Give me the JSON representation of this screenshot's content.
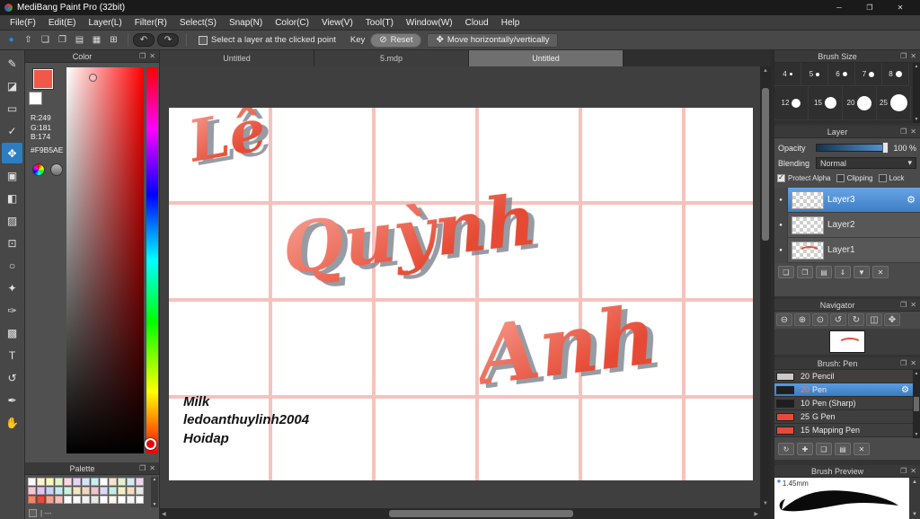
{
  "window": {
    "title": "MediBang Paint Pro (32bit)",
    "minimize": "─",
    "restore": "❐",
    "close": "✕"
  },
  "menu": [
    "File(F)",
    "Edit(E)",
    "Layer(L)",
    "Filter(R)",
    "Select(S)",
    "Snap(N)",
    "Color(C)",
    "View(V)",
    "Tool(T)",
    "Window(W)",
    "Cloud",
    "Help"
  ],
  "toolbar": {
    "icons": [
      {
        "name": "main-color-icon",
        "glyph": "●",
        "color": "#2f86d6"
      },
      {
        "name": "save-icon",
        "glyph": "⇧"
      },
      {
        "name": "comment-icon",
        "glyph": "❏"
      },
      {
        "name": "panels-icon",
        "glyph": "❐"
      },
      {
        "name": "grid-icon",
        "glyph": "▤"
      },
      {
        "name": "material-icon",
        "glyph": "▦"
      },
      {
        "name": "window-layout-icon",
        "glyph": "⊞"
      }
    ],
    "undo": "↶",
    "redo": "↷",
    "select_layer_label": "Select a layer at the clicked point",
    "key_label": "Key",
    "reset": {
      "icon": "⊘",
      "label": "Reset"
    },
    "move": {
      "icon": "✥",
      "label": "Move horizontally/vertically"
    }
  },
  "tools": [
    {
      "name": "pen-tool-icon",
      "glyph": "✎"
    },
    {
      "name": "eraser-tool-icon",
      "glyph": "◪"
    },
    {
      "name": "select-tool-icon",
      "glyph": "▭"
    },
    {
      "name": "auto-select-tool-icon",
      "glyph": "✓"
    },
    {
      "name": "move-tool-icon",
      "glyph": "✥",
      "active": true
    },
    {
      "name": "fill-tool-icon",
      "glyph": "▣"
    },
    {
      "name": "bucket-tool-icon",
      "glyph": "◧"
    },
    {
      "name": "gradient-tool-icon",
      "glyph": "▨"
    },
    {
      "name": "select-rect-tool-icon",
      "glyph": "⊡"
    },
    {
      "name": "lasso-tool-icon",
      "glyph": "○"
    },
    {
      "name": "magic-wand-tool-icon",
      "glyph": "✦"
    },
    {
      "name": "draw-tool-icon",
      "glyph": "✑"
    },
    {
      "name": "stamp-tool-icon",
      "glyph": "▩"
    },
    {
      "name": "text-tool-icon",
      "glyph": "T"
    },
    {
      "name": "rotate-tool-icon",
      "glyph": "↺"
    },
    {
      "name": "eyedropper-tool-icon",
      "glyph": "✒"
    },
    {
      "name": "hand-tool-icon",
      "glyph": "✋"
    }
  ],
  "color_panel": {
    "title": "Color",
    "r": "R:249",
    "g": "G:181",
    "b": "B:174",
    "hex": "#F9B5AE",
    "primary": "#F05848"
  },
  "palette_panel": {
    "title": "Palette",
    "footer": "| ---",
    "swatches": [
      "#ffffff",
      "#fdf3d0",
      "#faf6c0",
      "#e4f4c8",
      "#fad8e0",
      "#e6d6f2",
      "#d4e4f6",
      "#cdeef0",
      "#ffffff",
      "#f4e4ce",
      "#e2f0d4",
      "#d4e8f4",
      "#f0d6ea",
      "#f6c6d2",
      "#e0c6ee",
      "#c6d4f0",
      "#c6eaf0",
      "#cef0da",
      "#f0e8c2",
      "#f0d6c2",
      "#eec6c6",
      "#dadaf4",
      "#c6eede",
      "#f2eec4",
      "#eedcc4",
      "#e6e6e6",
      "#f08468",
      "#e84c38",
      "#f0a28e",
      "#f6c0b4",
      "#ffffff",
      "#f8f8f8",
      "#f0f0f0",
      "#e8e8e8",
      "#ffffff",
      "#fdf6ec",
      "#ffffff",
      "#f4f4f4",
      "#ffffff"
    ]
  },
  "tabs": [
    {
      "label": "Untitled"
    },
    {
      "label": "5.mdp"
    },
    {
      "label": "Untitled",
      "active": true
    }
  ],
  "canvas": {
    "lettering": {
      "line1": "Lê",
      "line2": "Quỳnh",
      "line3": "Anh"
    },
    "watermark": [
      "Milk",
      "ledoanthuylinh2004",
      "Hoidap"
    ]
  },
  "brush_size_panel": {
    "title": "Brush Size",
    "row1": [
      {
        "label": "4",
        "d": "3px"
      },
      {
        "label": "5",
        "d": "4px"
      },
      {
        "label": "6",
        "d": "5px"
      },
      {
        "label": "7",
        "d": "6px"
      },
      {
        "label": "8",
        "d": "7px"
      }
    ],
    "row2": [
      {
        "label": "12",
        "d": "10px"
      },
      {
        "label": "15",
        "d": "13px"
      },
      {
        "label": "20",
        "d": "16px"
      },
      {
        "label": "25",
        "d": "19px"
      }
    ]
  },
  "layer_panel": {
    "title": "Layer",
    "opacity_label": "Opacity",
    "opacity_value": "100 %",
    "blending_label": "Blending",
    "blending_value": "Normal",
    "caret": "▾",
    "visible_icon": "●",
    "gear_icon": "⚙",
    "checks": [
      {
        "label": "Protect Alpha",
        "checked": true
      },
      {
        "label": "Clipping"
      },
      {
        "label": "Lock"
      }
    ],
    "layers": [
      {
        "name": "Layer3",
        "active": true
      },
      {
        "name": "Layer2"
      },
      {
        "name": "Layer1",
        "scribble": true
      }
    ],
    "actions": [
      {
        "name": "new-layer-icon",
        "glyph": "❏"
      },
      {
        "name": "duplicate-layer-icon",
        "glyph": "❐"
      },
      {
        "name": "layer-folder-icon",
        "glyph": "▤"
      },
      {
        "name": "transfer-layer-icon",
        "glyph": "⇓"
      },
      {
        "name": "merge-layer-icon",
        "glyph": "▼"
      },
      {
        "name": "delete-layer-icon",
        "glyph": "✕"
      }
    ]
  },
  "navigator_panel": {
    "title": "Navigator",
    "icons": [
      {
        "name": "zoom-out-icon",
        "glyph": "⊖"
      },
      {
        "name": "zoom-in-icon",
        "glyph": "⊕"
      },
      {
        "name": "zoom-reset-icon",
        "glyph": "⊙"
      },
      {
        "name": "rotate-left-icon",
        "glyph": "↺"
      },
      {
        "name": "rotate-right-icon",
        "glyph": "↻"
      },
      {
        "name": "flip-icon",
        "glyph": "◫"
      },
      {
        "name": "fit-view-icon",
        "glyph": "✥"
      }
    ]
  },
  "brush_panel": {
    "title": "Brush: Pen",
    "gear_icon": "⚙",
    "brushes": [
      {
        "size": "20",
        "name": "Pencil",
        "swatch": "#c9c9c9"
      },
      {
        "size": "20",
        "name": "Pen",
        "swatch": "#1e1e1e",
        "active": true,
        "size_color": "#ff7a5a"
      },
      {
        "size": "10",
        "name": "Pen (Sharp)",
        "swatch": "#1e1e1e"
      },
      {
        "size": "25",
        "name": "G Pen",
        "swatch": "#e8493a"
      },
      {
        "size": "15",
        "name": "Mapping Pen",
        "swatch": "#e8493a"
      }
    ],
    "actions": [
      {
        "name": "refresh-brush-icon",
        "glyph": "↻"
      },
      {
        "name": "add-brush-icon",
        "glyph": "✚"
      },
      {
        "name": "brush-folder-icon",
        "glyph": "❏"
      },
      {
        "name": "brush-settings-icon",
        "glyph": "▤"
      },
      {
        "name": "delete-brush-icon",
        "glyph": "✕"
      }
    ]
  },
  "preview_panel": {
    "title": "Brush Preview",
    "star": "*",
    "size_label": "1.45mm"
  },
  "panel_icons": {
    "popout": "❐",
    "close": "✕"
  },
  "scroll": {
    "up": "▲",
    "down": "▼",
    "left": "◀",
    "right": "▶"
  }
}
